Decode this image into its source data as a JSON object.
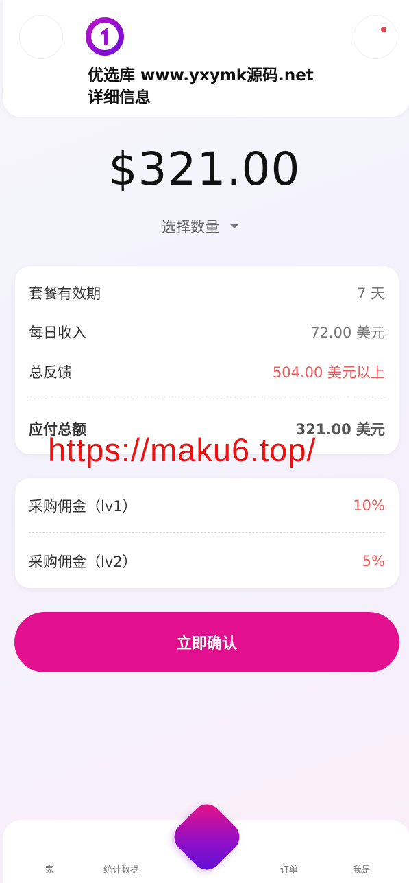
{
  "header": {
    "site_name": "优选库 www.yxymk源码.net",
    "title": "详细信息"
  },
  "price": {
    "amount": "$321.00",
    "quantity_label": "选择数量"
  },
  "details": {
    "rows": [
      {
        "label": "套餐有效期",
        "value": "7 天"
      },
      {
        "label": "每日收入",
        "value": "72.00 美元"
      },
      {
        "label": "总反馈",
        "value": "504.00 美元以上"
      }
    ],
    "total": {
      "label": "应付总额",
      "value": "321.00 美元"
    }
  },
  "commission": {
    "rows": [
      {
        "label": "采购佣金（lv1）",
        "value": "10%"
      },
      {
        "label": "采购佣金（lv2）",
        "value": "5%"
      }
    ]
  },
  "watermark": "https://maku6.top/",
  "confirm_label": "立即确认",
  "nav": {
    "items": [
      {
        "label": "家"
      },
      {
        "label": "统计数据"
      },
      {
        "label": "订单"
      },
      {
        "label": "我是"
      }
    ]
  },
  "colors": {
    "accent": "#e2108e",
    "highlight_red": "#f05a5a",
    "notification_dot": "#e8444e"
  }
}
